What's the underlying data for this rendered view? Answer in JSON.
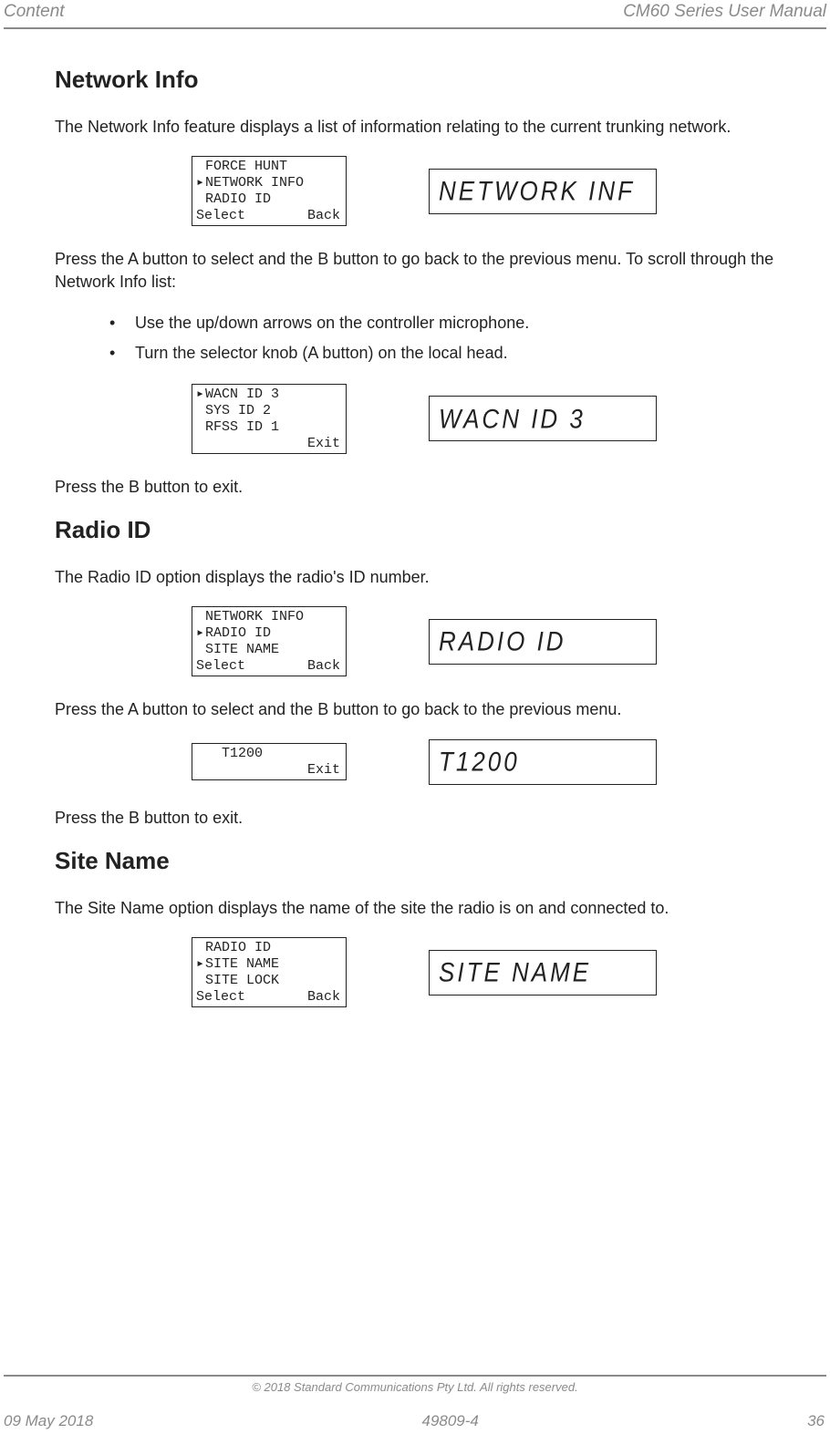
{
  "header": {
    "left": "Content",
    "right": "CM60 Series User Manual"
  },
  "network_info": {
    "heading": "Network Info",
    "intro": "The Network Info feature displays a list of information relating to the current trunking network.",
    "menu1": {
      "lines": [
        {
          "marker": "",
          "text": "FORCE HUNT"
        },
        {
          "marker": "▸",
          "text": "NETWORK INFO"
        },
        {
          "marker": "",
          "text": "RADIO ID"
        }
      ],
      "soft_left": "Select",
      "soft_right": "Back",
      "segment": "NETWORK INF"
    },
    "after1": "Press the A button to select and the B button to go back to the previous menu. To scroll through the Network Info list:",
    "bullets": [
      "Use the up/down arrows on the controller microphone.",
      "Turn the selector knob (A button) on the local head."
    ],
    "menu2": {
      "lines": [
        {
          "marker": "▸",
          "text": "WACN ID 3"
        },
        {
          "marker": "",
          "text": "SYS ID 2"
        },
        {
          "marker": "",
          "text": "RFSS ID 1"
        }
      ],
      "soft_left": "",
      "soft_right": "Exit",
      "segment": "WACN ID 3"
    },
    "after2": "Press the B button to exit."
  },
  "radio_id": {
    "heading": "Radio ID",
    "intro": "The Radio ID option displays the radio's ID number.",
    "menu1": {
      "lines": [
        {
          "marker": "",
          "text": "NETWORK INFO"
        },
        {
          "marker": "▸",
          "text": "RADIO ID"
        },
        {
          "marker": "",
          "text": "SITE NAME"
        }
      ],
      "soft_left": "Select",
      "soft_right": "Back",
      "segment": "RADIO  ID"
    },
    "after1": "Press the A button to select and the B button to go back to the previous menu.",
    "menu2": {
      "lines": [
        {
          "marker": "",
          "text": ""
        },
        {
          "marker": "",
          "text": "  T1200"
        },
        {
          "marker": "",
          "text": ""
        }
      ],
      "soft_left": "",
      "soft_right": "Exit",
      "segment": "T1200"
    },
    "after2": "Press the B button to exit."
  },
  "site_name": {
    "heading": "Site Name",
    "intro": "The Site Name option displays the name of the site the radio is on and connected to.",
    "menu1": {
      "lines": [
        {
          "marker": "",
          "text": "RADIO ID"
        },
        {
          "marker": "▸",
          "text": "SITE NAME"
        },
        {
          "marker": "",
          "text": "SITE LOCK"
        }
      ],
      "soft_left": "Select",
      "soft_right": "Back",
      "segment": "SITE NAME"
    }
  },
  "footer": {
    "copyright": "© 2018 Standard Communications Pty Ltd. All rights reserved.",
    "left": "09 May 2018",
    "center": "49809-4",
    "right": "36"
  }
}
